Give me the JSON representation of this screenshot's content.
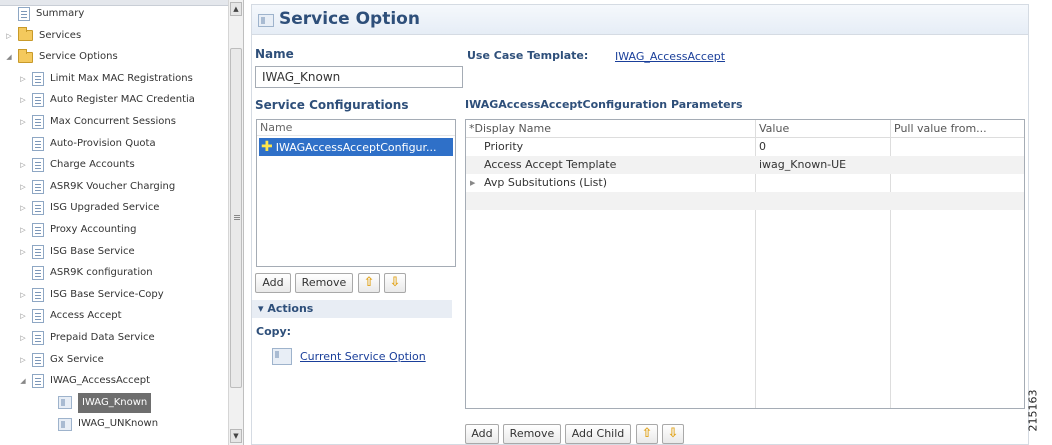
{
  "tree": {
    "items": [
      {
        "label": "Summary",
        "icon": "doc-icon",
        "arrow": "",
        "indent": 0
      },
      {
        "label": "Services",
        "icon": "folder-icon",
        "arrow": "collapsed",
        "indent": 0
      },
      {
        "label": "Service Options",
        "icon": "folder-icon",
        "arrow": "expanded",
        "indent": 0
      },
      {
        "label": "Limit Max MAC Registrations",
        "icon": "doc-icon",
        "arrow": "collapsed",
        "indent": 1
      },
      {
        "label": "Auto Register MAC Credentia",
        "icon": "doc-icon",
        "arrow": "collapsed",
        "indent": 1
      },
      {
        "label": "Max Concurrent Sessions",
        "icon": "doc-icon",
        "arrow": "collapsed",
        "indent": 1
      },
      {
        "label": "Auto-Provision Quota",
        "icon": "doc-icon",
        "arrow": "",
        "indent": 1
      },
      {
        "label": "Charge Accounts",
        "icon": "doc-icon",
        "arrow": "collapsed",
        "indent": 1
      },
      {
        "label": "ASR9K Voucher Charging",
        "icon": "doc-icon",
        "arrow": "collapsed",
        "indent": 1
      },
      {
        "label": "ISG Upgraded Service",
        "icon": "doc-icon",
        "arrow": "collapsed",
        "indent": 1
      },
      {
        "label": "Proxy Accounting",
        "icon": "doc-icon",
        "arrow": "collapsed",
        "indent": 1
      },
      {
        "label": "ISG Base Service",
        "icon": "doc-icon",
        "arrow": "collapsed",
        "indent": 1
      },
      {
        "label": "ASR9K configuration",
        "icon": "doc-icon",
        "arrow": "",
        "indent": 1
      },
      {
        "label": "ISG Base Service-Copy",
        "icon": "doc-icon",
        "arrow": "collapsed",
        "indent": 1
      },
      {
        "label": "Access Accept",
        "icon": "doc-icon",
        "arrow": "collapsed",
        "indent": 1
      },
      {
        "label": "Prepaid Data Service",
        "icon": "doc-icon",
        "arrow": "collapsed",
        "indent": 1
      },
      {
        "label": "Gx Service",
        "icon": "doc-icon",
        "arrow": "collapsed",
        "indent": 1
      },
      {
        "label": "IWAG_AccessAccept",
        "icon": "doc-icon",
        "arrow": "expanded",
        "indent": 1
      },
      {
        "label": "IWAG_Known",
        "icon": "service-icon",
        "arrow": "",
        "indent": 2,
        "selected": true
      },
      {
        "label": "IWAG_UNKnown",
        "icon": "service-icon",
        "arrow": "",
        "indent": 2
      }
    ]
  },
  "main": {
    "title": "Service Option",
    "name_label": "Name",
    "name_value": "IWAG_Known",
    "use_case_label": "Use Case Template:",
    "use_case_link": "IWAG_AccessAccept",
    "service_configurations_label": "Service Configurations",
    "config_list": {
      "header": "Name",
      "items": [
        "IWAGAccessAcceptConfigur..."
      ]
    },
    "config_buttons": {
      "add": "Add",
      "remove": "Remove",
      "up": "⇧",
      "down": "⇩"
    },
    "actions": {
      "header": "Actions",
      "copy_label": "Copy:",
      "current_link": "Current Service Option"
    },
    "params_label": "IWAGAccessAcceptConfiguration Parameters",
    "params_table": {
      "columns": [
        "*Display Name",
        "Value",
        "Pull value from..."
      ],
      "rows": [
        {
          "name": "Priority",
          "value": "0",
          "pull": ""
        },
        {
          "name": "Access Accept Template",
          "value": "iwag_Known-UE",
          "pull": ""
        },
        {
          "name": "Avp Subsitutions (List)",
          "value": "",
          "pull": "",
          "expandable": true
        }
      ]
    },
    "params_buttons": {
      "add": "Add",
      "remove": "Remove",
      "add_child": "Add Child",
      "up": "⇧",
      "down": "⇩"
    }
  },
  "figure_id": "215163"
}
